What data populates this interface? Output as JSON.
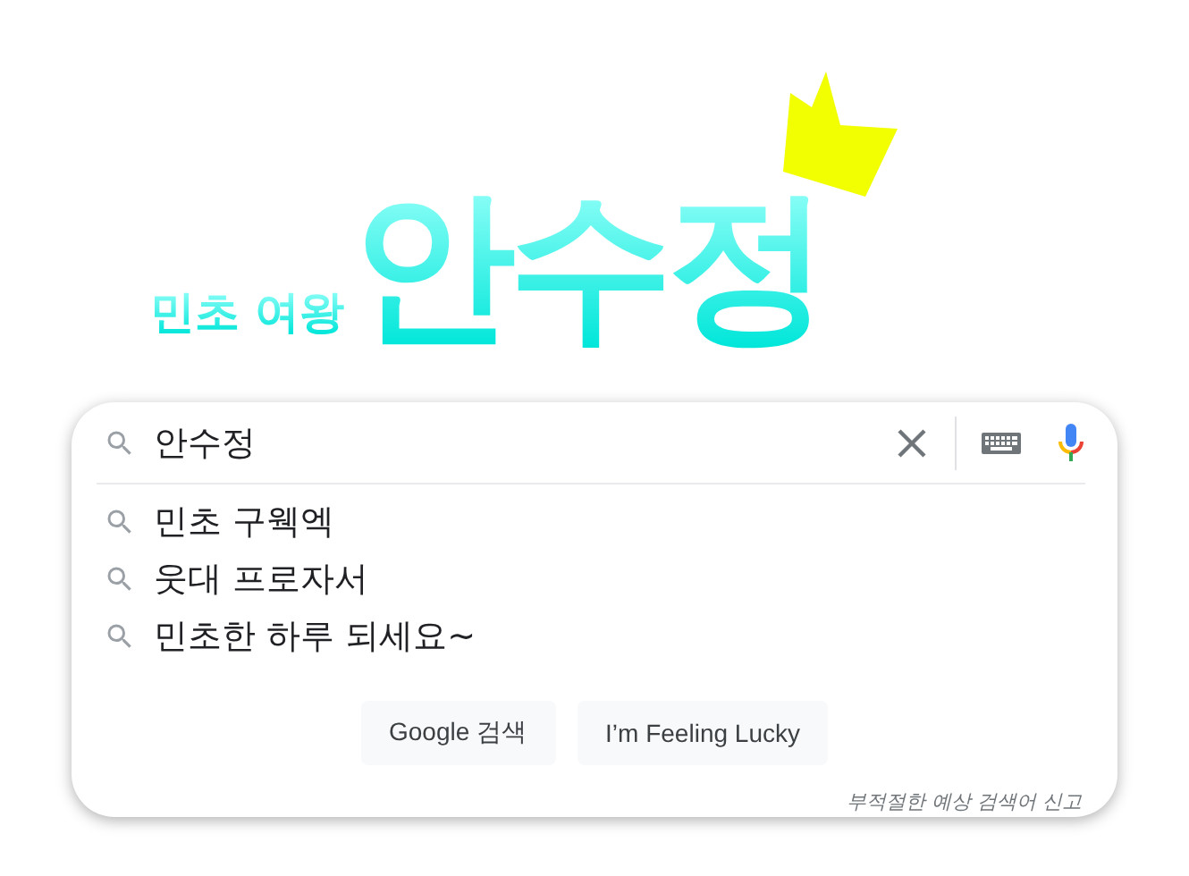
{
  "logo": {
    "subtitle": "민초 여왕",
    "title": "안수정"
  },
  "search": {
    "value": "안수정"
  },
  "suggestions": [
    "민초 구웩엑",
    "웃대 프로자서",
    "민초한 하루 되세요~"
  ],
  "buttons": [
    "Google 검색",
    "I’m Feeling Lucky"
  ],
  "report_link": "부적절한 예상 검색어 신고"
}
